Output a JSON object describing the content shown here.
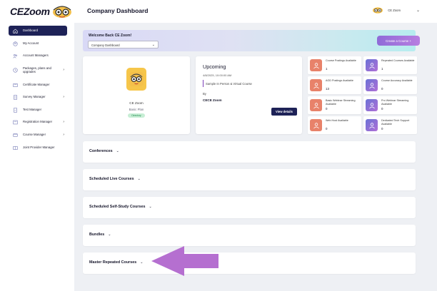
{
  "header": {
    "logo_text": "CEZoom",
    "page_title": "Company Dashboard",
    "user_name": "CE Zoom"
  },
  "sidebar": {
    "items": [
      {
        "label": "Dashboard",
        "icon": "home-icon",
        "active": true,
        "has_submenu": false
      },
      {
        "label": "My Account",
        "icon": "account-icon",
        "active": false,
        "has_submenu": false
      },
      {
        "label": "Account Managers",
        "icon": "users-icon",
        "active": false,
        "has_submenu": false
      },
      {
        "label": "Packages, plans and upgrades",
        "icon": "package-icon",
        "active": false,
        "has_submenu": true
      },
      {
        "label": "Certificate Manager",
        "icon": "certificate-icon",
        "active": false,
        "has_submenu": false
      },
      {
        "label": "Survey Manager",
        "icon": "survey-icon",
        "active": false,
        "has_submenu": true
      },
      {
        "label": "Test Manager",
        "icon": "test-icon",
        "active": false,
        "has_submenu": false
      },
      {
        "label": "Registration Manager",
        "icon": "registration-icon",
        "active": false,
        "has_submenu": true
      },
      {
        "label": "Course Manager",
        "icon": "course-icon",
        "active": false,
        "has_submenu": true
      },
      {
        "label": "Joint Provider Manager",
        "icon": "joint-provider-icon",
        "active": false,
        "has_submenu": false
      }
    ]
  },
  "banner": {
    "welcome": "Welcome Back CE Zoom!",
    "select_value": "Company Dashboard",
    "create_button": "Create a Course +"
  },
  "plan_card": {
    "name": "CE Zoom",
    "plan": "Basic Plan",
    "badge": "Directory"
  },
  "upcoming": {
    "title": "Upcoming",
    "date": "4/8/2025, 10:00:00 AM",
    "course_type": "Sample In Person & Virtual Course",
    "by_label": "By",
    "organizer": "CECE Zoom",
    "view_button": "View details"
  },
  "stats": [
    {
      "label": "Course Postings Available",
      "value": "1",
      "color": "#e8826a"
    },
    {
      "label": "Repeated Courses Available",
      "value": "1",
      "color": "#8e6fd0"
    },
    {
      "label": "AGD Postings Available",
      "value": "13",
      "color": "#e8826a"
    },
    {
      "label": "Course Accuracy Available",
      "value": "0",
      "color": "#8e6fd0"
    },
    {
      "label": "Basic Webinar Streaming Available",
      "value": "0",
      "color": "#e8826a"
    },
    {
      "label": "Pro Webinar Streaming Available",
      "value": "0",
      "color": "#8e6fd0"
    },
    {
      "label": "Web Host Available",
      "value": "0",
      "color": "#e8826a"
    },
    {
      "label": "Dedicated Tech Support Available",
      "value": "0",
      "color": "#8e6fd0"
    }
  ],
  "sections": [
    {
      "title": "Conferences"
    },
    {
      "title": "Scheduled Live Courses"
    },
    {
      "title": "Scheduled Self-Study Courses"
    },
    {
      "title": "Bundles"
    },
    {
      "title": "Master Repeated Courses"
    }
  ],
  "colors": {
    "nav_active": "#1e2257",
    "accent_purple": "#9b59c6",
    "arrow": "#b56fd0",
    "badge_bg": "#c7eed5"
  }
}
